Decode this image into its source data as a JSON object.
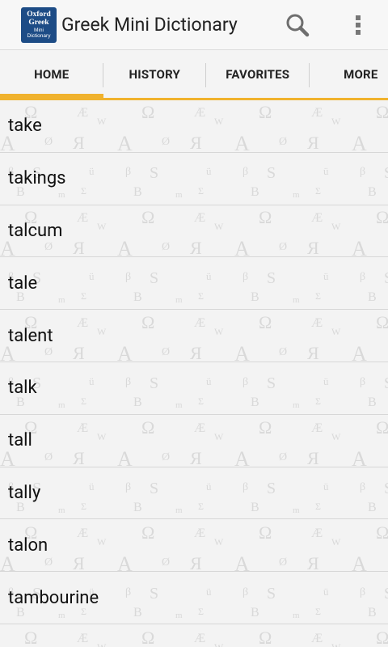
{
  "app": {
    "title": "Greek Mini Dictionary",
    "icon_lines": [
      "Oxford",
      "Greek",
      "Mini",
      "Dictionary"
    ]
  },
  "actions": {
    "search_icon": "search-icon",
    "overflow_icon": "overflow-menu-icon"
  },
  "tabs": [
    {
      "label": "HOME",
      "active": true
    },
    {
      "label": "HISTORY",
      "active": false
    },
    {
      "label": "FAVORITES",
      "active": false
    },
    {
      "label": "MORE",
      "active": false
    }
  ],
  "words": [
    "take",
    "takings",
    "talcum",
    "tale",
    "talent",
    "talk",
    "tall",
    "tally",
    "talon",
    "tambourine"
  ],
  "colors": {
    "accent": "#f0b22d",
    "icon_bg": "#1d4c86"
  }
}
